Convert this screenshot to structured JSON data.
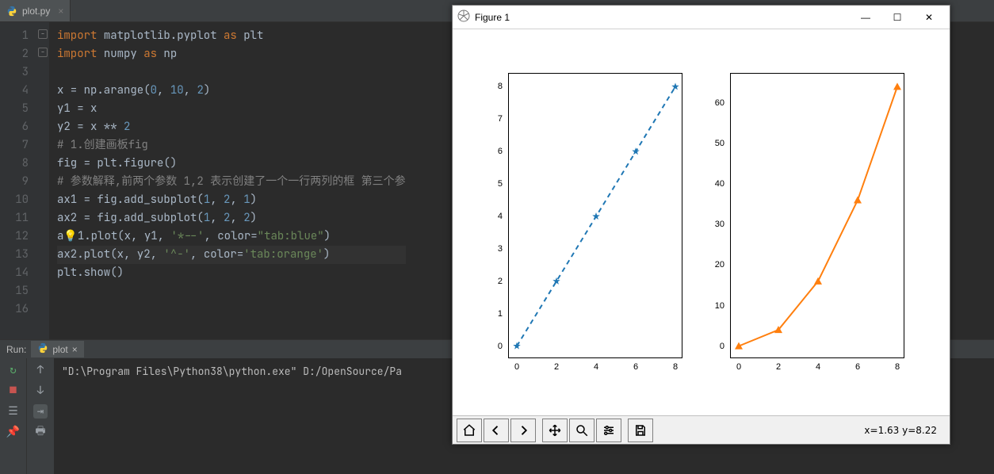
{
  "editor": {
    "tab_filename": "plot.py",
    "line_numbers": [
      "1",
      "2",
      "3",
      "4",
      "5",
      "6",
      "7",
      "8",
      "9",
      "10",
      "11",
      "12",
      "13",
      "14",
      "15",
      "16"
    ],
    "code_lines": [
      {
        "tokens": [
          {
            "t": "import ",
            "c": "kw"
          },
          {
            "t": "matplotlib.pyplot ",
            "c": "id"
          },
          {
            "t": "as ",
            "c": "kw"
          },
          {
            "t": "plt",
            "c": "id"
          }
        ]
      },
      {
        "tokens": [
          {
            "t": "import ",
            "c": "kw"
          },
          {
            "t": "numpy ",
            "c": "id"
          },
          {
            "t": "as ",
            "c": "kw"
          },
          {
            "t": "np",
            "c": "id"
          }
        ]
      },
      {
        "tokens": []
      },
      {
        "tokens": [
          {
            "t": "x = np.arange(",
            "c": "id"
          },
          {
            "t": "0",
            "c": "num"
          },
          {
            "t": ", ",
            "c": "id"
          },
          {
            "t": "10",
            "c": "num"
          },
          {
            "t": ", ",
            "c": "id"
          },
          {
            "t": "2",
            "c": "num"
          },
          {
            "t": ")",
            "c": "id"
          }
        ]
      },
      {
        "tokens": [
          {
            "t": "y1 = x",
            "c": "id"
          }
        ]
      },
      {
        "tokens": [
          {
            "t": "y2 = x ** ",
            "c": "id"
          },
          {
            "t": "2",
            "c": "num"
          }
        ]
      },
      {
        "tokens": [
          {
            "t": "# 1.创建画板fig",
            "c": "cm"
          }
        ]
      },
      {
        "tokens": [
          {
            "t": "fig = plt.figure()",
            "c": "id"
          }
        ]
      },
      {
        "tokens": [
          {
            "t": "# 参数解释,前两个参数 1,2 表示创建了一个一行两列的框 第三个参",
            "c": "cm"
          }
        ]
      },
      {
        "tokens": [
          {
            "t": "ax1 = fig.add_subplot(",
            "c": "id"
          },
          {
            "t": "1",
            "c": "num"
          },
          {
            "t": ", ",
            "c": "id"
          },
          {
            "t": "2",
            "c": "num"
          },
          {
            "t": ", ",
            "c": "id"
          },
          {
            "t": "1",
            "c": "num"
          },
          {
            "t": ")",
            "c": "id"
          }
        ]
      },
      {
        "tokens": [
          {
            "t": "ax2 = fig.add_subplot(",
            "c": "id"
          },
          {
            "t": "1",
            "c": "num"
          },
          {
            "t": ", ",
            "c": "id"
          },
          {
            "t": "2",
            "c": "num"
          },
          {
            "t": ", ",
            "c": "id"
          },
          {
            "t": "2",
            "c": "num"
          },
          {
            "t": ")",
            "c": "id"
          }
        ]
      },
      {
        "tokens": [
          {
            "t": "a",
            "c": "id"
          },
          {
            "t": "💡",
            "c": "bulb"
          },
          {
            "t": "1.plot(x, y1, ",
            "c": "id"
          },
          {
            "t": "'*--'",
            "c": "str"
          },
          {
            "t": ", ",
            "c": "id"
          },
          {
            "t": "color=",
            "c": "id"
          },
          {
            "t": "\"tab:blue\"",
            "c": "str"
          },
          {
            "t": ")",
            "c": "id"
          }
        ]
      },
      {
        "tokens": [
          {
            "t": "ax2.plot(x, y2, ",
            "c": "id"
          },
          {
            "t": "'^-'",
            "c": "str"
          },
          {
            "t": ", ",
            "c": "id"
          },
          {
            "t": "color=",
            "c": "id"
          },
          {
            "t": "'tab:orange'",
            "c": "str"
          },
          {
            "t": ")",
            "c": "id"
          }
        ],
        "highlight": true
      },
      {
        "tokens": [
          {
            "t": "plt.show()",
            "c": "id"
          }
        ]
      },
      {
        "tokens": []
      },
      {
        "tokens": []
      }
    ]
  },
  "run": {
    "label": "Run:",
    "tab_name": "plot",
    "console_line": "\"D:\\Program Files\\Python38\\python.exe\" D:/OpenSource/Pa"
  },
  "figure": {
    "title": "Figure 1",
    "coord_readout": "x=1.63 y=8.22",
    "toolbar": {
      "home": "home-icon",
      "back": "back-icon",
      "forward": "forward-icon",
      "pan": "pan-icon",
      "zoom": "zoom-icon",
      "configure": "configure-icon",
      "save": "save-icon"
    }
  },
  "chart_data": [
    {
      "type": "line",
      "style": "dashed-star",
      "color": "#1f77b4",
      "x": [
        0,
        2,
        4,
        6,
        8
      ],
      "y": [
        0,
        2,
        4,
        6,
        8
      ],
      "x_ticks": [
        0,
        2,
        4,
        6,
        8
      ],
      "y_ticks": [
        0,
        1,
        2,
        3,
        4,
        5,
        6,
        7,
        8
      ],
      "xlim": [
        -0.4,
        8.4
      ],
      "ylim": [
        -0.4,
        8.4
      ]
    },
    {
      "type": "line",
      "style": "solid-triangle",
      "color": "#ff7f0e",
      "x": [
        0,
        2,
        4,
        6,
        8
      ],
      "y": [
        0,
        4,
        16,
        36,
        64
      ],
      "x_ticks": [
        0,
        2,
        4,
        6,
        8
      ],
      "y_ticks": [
        0,
        10,
        20,
        30,
        40,
        50,
        60
      ],
      "xlim": [
        -0.4,
        8.4
      ],
      "ylim": [
        -3.2,
        67.2
      ]
    }
  ]
}
